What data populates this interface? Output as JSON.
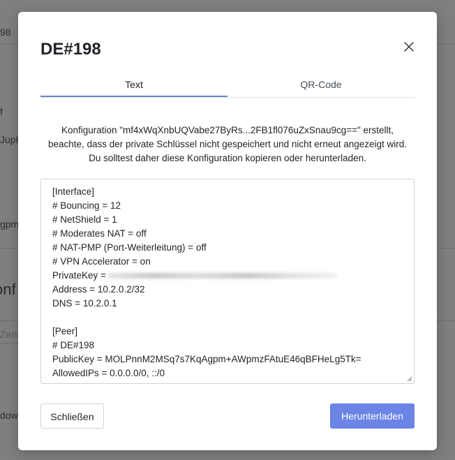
{
  "background": {
    "fragments": [
      "98",
      "f",
      "JupK",
      "gpm",
      "onf",
      "Zerti",
      "dow"
    ]
  },
  "modal": {
    "title": "DE#198",
    "close_icon": "close-icon",
    "tabs": [
      {
        "label": "Text",
        "active": true
      },
      {
        "label": "QR-Code",
        "active": false
      }
    ],
    "description": [
      "Konfiguration \"mf4xWqXnbUQVabe27ByRs...2FB1fl076uZxSnau9cg==\" erstellt,",
      "beachte, dass der private Schlüssel nicht gespeichert und nicht erneut angezeigt wird.",
      "Du solltest daher diese Konfiguration kopieren oder herunterladen."
    ],
    "config_lines": [
      "[Interface]",
      "# Bouncing = 12",
      "# NetShield = 1",
      "# Moderates NAT = off",
      "# NAT-PMP (Port-Weiterleitung) = off",
      "# VPN Accelerator = on",
      "PrivateKey =",
      "Address = 10.2.0.2/32",
      "DNS = 10.2.0.1",
      "",
      "[Peer]",
      "# DE#198",
      "PublicKey = MOLPnnM2MSq7s7KqAgpm+AWpmzFAtuE46qBFHeLg5Tk=",
      "AllowedIPs = 0.0.0.0/0, ::/0"
    ],
    "buttons": {
      "close_label": "Schließen",
      "download_label": "Herunterladen"
    },
    "colors": {
      "accent": "#6b84e6",
      "tab_underline": "#6b84c7"
    }
  }
}
